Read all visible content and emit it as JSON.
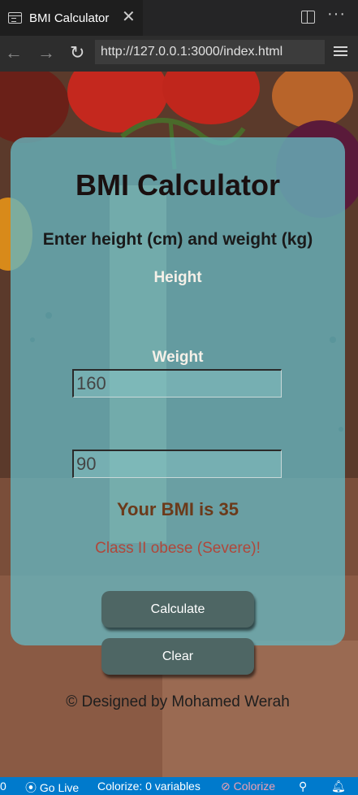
{
  "browser": {
    "tab_title": "BMI Calculator",
    "tab_close": "✕",
    "more": "···",
    "back": "←",
    "forward": "→",
    "reload": "↻",
    "url": "http://127.0.0.1:3000/index.html"
  },
  "calculator": {
    "title": "BMI Calculator",
    "subtitle": "Enter height (cm) and weight (kg)",
    "height_label": "Height",
    "height_value": "160",
    "weight_label": "Weight",
    "weight_value": "90",
    "result": "Your BMI is 35",
    "category": "Class II obese (Severe)!",
    "calculate_label": "Calculate",
    "clear_label": "Clear",
    "credit": "© Designed by Mohamed Werah"
  },
  "statusbar": {
    "left_count": "0",
    "go_live": "Go Live",
    "colorize_vars": "Colorize: 0 variables",
    "colorize": "Colorize"
  },
  "colors": {
    "card": "#66b4be",
    "button": "#4e6664",
    "result": "#6b3a1a",
    "category": "#b0473a",
    "statusbar": "#007acc"
  }
}
